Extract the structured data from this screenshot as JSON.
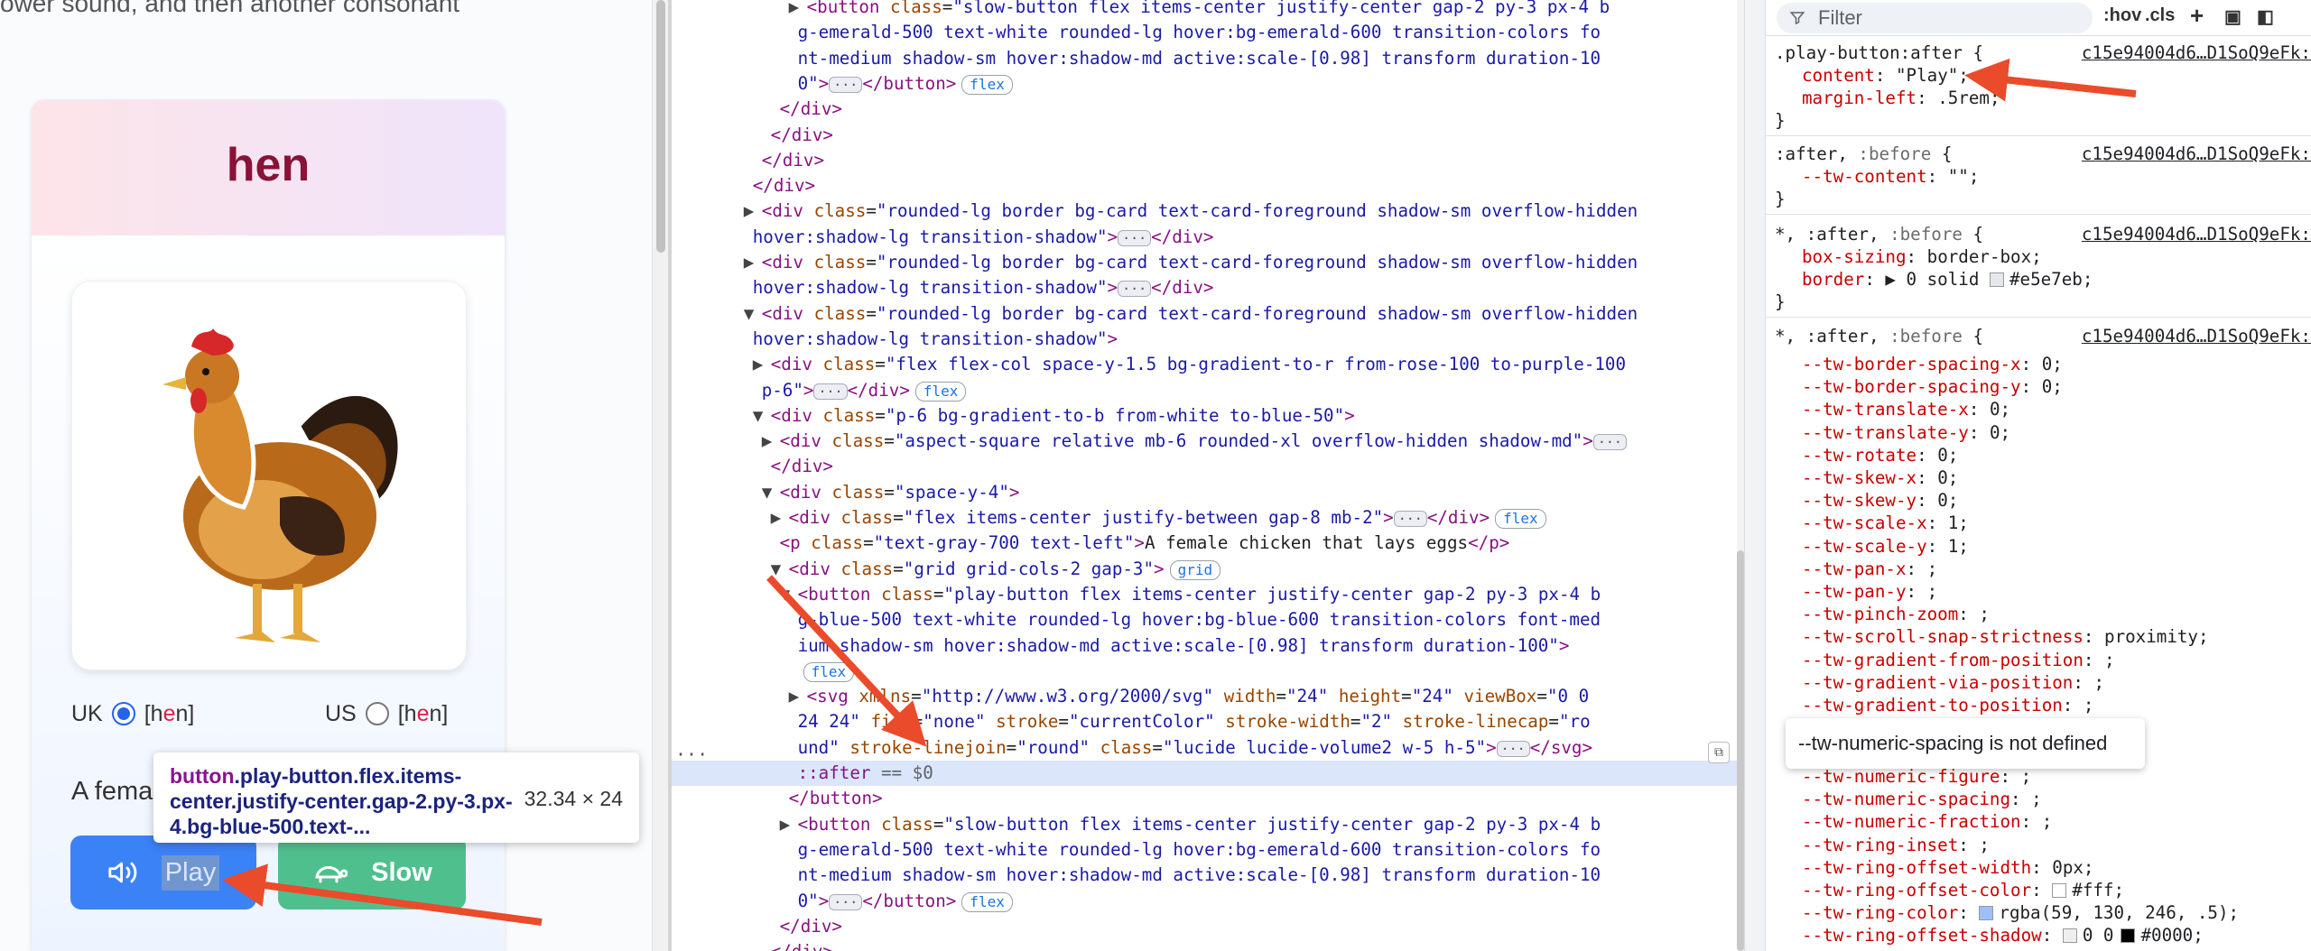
{
  "page": {
    "top_text": "ower sound, and then another consonant",
    "card": {
      "word": "hen",
      "uk_label": "UK",
      "uk_ipa_pre": "[h",
      "uk_ipa_mid": "e",
      "uk_ipa_post": "n]",
      "us_label": "US",
      "us_ipa_pre": "[h",
      "us_ipa_mid": "e",
      "us_ipa_post": "n]",
      "description_visible": "A fema",
      "play_label": "Play",
      "slow_label": "Slow"
    },
    "tooltip": {
      "selector_tag": "button",
      "selector_rest": ".play-button.flex.items-center.justify-center.gap-2.py-3.px-4.bg-blue-500.text-...",
      "size": "32.34 × 24"
    }
  },
  "elements": {
    "lines": [
      {
        "indent": 11,
        "html": "<span class='tri'>▶</span><span class='t'>&lt;button</span> <span class='an'>class</span>=<span class='av'>\"slow-button flex items-center justify-center gap-2 py-3 px-4 b</span>"
      },
      {
        "indent": 12,
        "html": "<span class='av'>g-emerald-500 text-white rounded-lg hover:bg-emerald-600 transition-colors fo</span>"
      },
      {
        "indent": 12,
        "html": "<span class='av'>nt-medium shadow-sm hover:shadow-md active:scale-[0.98] transform duration-10</span>"
      },
      {
        "indent": 12,
        "html": "<span class='av'>0\"</span><span class='t'>&gt;</span><span class='dots'>···</span><span class='t'>&lt;/button&gt;</span><span class='pill'>flex</span>"
      },
      {
        "indent": 10,
        "html": "<span class='t'>&lt;/div&gt;</span>"
      },
      {
        "indent": 9,
        "html": "<span class='t'>&lt;/div&gt;</span>"
      },
      {
        "indent": 8,
        "html": "<span class='t'>&lt;/div&gt;</span>"
      },
      {
        "indent": 7,
        "html": "<span class='t'>&lt;/div&gt;</span>"
      },
      {
        "indent": 6,
        "html": "<span class='tri'>▶</span><span class='t'>&lt;div</span> <span class='an'>class</span>=<span class='av'>\"rounded-lg border bg-card text-card-foreground shadow-sm overflow-hidden</span>"
      },
      {
        "indent": 7,
        "html": "<span class='av'>hover:shadow-lg transition-shadow\"</span><span class='t'>&gt;</span><span class='dots'>···</span><span class='t'>&lt;/div&gt;</span>"
      },
      {
        "indent": 6,
        "html": "<span class='tri'>▶</span><span class='t'>&lt;div</span> <span class='an'>class</span>=<span class='av'>\"rounded-lg border bg-card text-card-foreground shadow-sm overflow-hidden</span>"
      },
      {
        "indent": 7,
        "html": "<span class='av'>hover:shadow-lg transition-shadow\"</span><span class='t'>&gt;</span><span class='dots'>···</span><span class='t'>&lt;/div&gt;</span>"
      },
      {
        "indent": 6,
        "html": "<span class='tri'>▼</span><span class='t'>&lt;div</span> <span class='an'>class</span>=<span class='av'>\"rounded-lg border bg-card text-card-foreground shadow-sm overflow-hidden</span>"
      },
      {
        "indent": 7,
        "html": "<span class='av'>hover:shadow-lg transition-shadow\"</span><span class='t'>&gt;</span>"
      },
      {
        "indent": 7,
        "html": "<span class='tri'>▶</span><span class='t'>&lt;div</span> <span class='an'>class</span>=<span class='av'>\"flex flex-col space-y-1.5 bg-gradient-to-r from-rose-100 to-purple-100</span>"
      },
      {
        "indent": 8,
        "html": "<span class='av'>p-6\"</span><span class='t'>&gt;</span><span class='dots'>···</span><span class='t'>&lt;/div&gt;</span><span class='pill'>flex</span>"
      },
      {
        "indent": 7,
        "html": "<span class='tri'>▼</span><span class='t'>&lt;div</span> <span class='an'>class</span>=<span class='av'>\"p-6 bg-gradient-to-b from-white to-blue-50\"</span><span class='t'>&gt;</span>"
      },
      {
        "indent": 8,
        "html": "<span class='tri'>▶</span><span class='t'>&lt;div</span> <span class='an'>class</span>=<span class='av'>\"aspect-square relative mb-6 rounded-xl overflow-hidden shadow-md\"</span><span class='t'>&gt;</span><span class='dots'>···</span>"
      },
      {
        "indent": 9,
        "html": "<span class='t'>&lt;/div&gt;</span>"
      },
      {
        "indent": 8,
        "html": "<span class='tri'>▼</span><span class='t'>&lt;div</span> <span class='an'>class</span>=<span class='av'>\"space-y-4\"</span><span class='t'>&gt;</span>"
      },
      {
        "indent": 9,
        "html": "<span class='tri'>▶</span><span class='t'>&lt;div</span> <span class='an'>class</span>=<span class='av'>\"flex items-center justify-between gap-8 mb-2\"</span><span class='t'>&gt;</span><span class='dots'>···</span><span class='t'>&lt;/div&gt;</span><span class='pill'>flex</span>"
      },
      {
        "indent": 10,
        "html": "<span class='t'>&lt;p</span> <span class='an'>class</span>=<span class='av'>\"text-gray-700 text-left\"</span><span class='t'>&gt;</span>A female chicken that lays eggs<span class='t'>&lt;/p&gt;</span>"
      },
      {
        "indent": 9,
        "html": "<span class='tri'>▼</span><span class='t'>&lt;div</span> <span class='an'>class</span>=<span class='av'>\"grid grid-cols-2 gap-3\"</span><span class='t'>&gt;</span><span class='pill'>grid</span>"
      },
      {
        "indent": 10,
        "html": "<span class='tri'>▼</span><span class='t'>&lt;button</span> <span class='an'>class</span>=<span class='av'>\"play-button flex items-center justify-center gap-2 py-3 px-4 b</span>"
      },
      {
        "indent": 12,
        "html": "<span class='av'>g-blue-500 text-white rounded-lg hover:bg-blue-600 transition-colors font-med</span>"
      },
      {
        "indent": 12,
        "html": "<span class='av'>ium shadow-sm hover:shadow-md active:scale-[0.98] transform duration-100\"</span><span class='t'>&gt;</span>"
      },
      {
        "indent": 12,
        "html": "<span class='pill'>flex</span>"
      },
      {
        "indent": 11,
        "html": "<span class='tri'>▶</span><span class='t'>&lt;svg</span> <span class='an'>xmlns</span>=<span class='av'>\"http://www.w3.org/2000/svg\"</span> <span class='an'>width</span>=<span class='av'>\"24\"</span> <span class='an'>height</span>=<span class='av'>\"24\"</span> <span class='an'>viewBox</span>=<span class='av'>\"0 0</span>"
      },
      {
        "indent": 12,
        "html": "<span class='av'>24 24\"</span> <span class='an'>fill</span>=<span class='av'>\"none\"</span> <span class='an'>stroke</span>=<span class='av'>\"currentColor\"</span> <span class='an'>stroke-width</span>=<span class='av'>\"2\"</span> <span class='an'>stroke-linecap</span>=<span class='av'>\"ro</span>"
      },
      {
        "indent": 12,
        "html": "<span class='av'>und\"</span> <span class='an'>stroke-linejoin</span>=<span class='av'>\"round\"</span> <span class='an'>class</span>=<span class='av'>\"lucide lucide-volume2 w-5 h-5\"</span><span class='t'>&gt;</span><span class='dots'>···</span><span class='t'>&lt;/svg&gt;</span>"
      },
      {
        "indent": 12,
        "selected": true,
        "html": "<span class='t'>::after</span> <span class='cm'>== $0</span>"
      },
      {
        "indent": 11,
        "html": "<span class='t'>&lt;/button&gt;</span>"
      },
      {
        "indent": 10,
        "html": "<span class='tri'>▶</span><span class='t'>&lt;button</span> <span class='an'>class</span>=<span class='av'>\"slow-button flex items-center justify-center gap-2 py-3 px-4 b</span>"
      },
      {
        "indent": 12,
        "html": "<span class='av'>g-emerald-500 text-white rounded-lg hover:bg-emerald-600 transition-colors fo</span>"
      },
      {
        "indent": 12,
        "html": "<span class='av'>nt-medium shadow-sm hover:shadow-md active:scale-[0.98] transform duration-10</span>"
      },
      {
        "indent": 12,
        "html": "<span class='av'>0\"</span><span class='t'>&gt;</span><span class='dots'>···</span><span class='t'>&lt;/button&gt;</span><span class='pill'>flex</span>"
      },
      {
        "indent": 10,
        "html": "<span class='t'>&lt;/div&gt;</span>"
      },
      {
        "indent": 9,
        "html": "<span class='t'>&lt;/div&gt;</span>"
      }
    ]
  },
  "styles": {
    "filter_placeholder": "Filter",
    "hov": ":hov",
    "cls": ".cls",
    "source": "c15e94004d6…D1SoQ9eFk:",
    "play_after_selector": ".play-button:after {",
    "play_after_content_name": "content",
    "play_after_content_value": "\"Play\";",
    "play_after_margin_name": "margin-left",
    "play_after_margin_value": ".5rem;",
    "after_before_selector_a": ":after",
    "after_before_selector_b": ":before",
    "tw_content_name": "--tw-content",
    "tw_content_value": "\"\";",
    "box_sizing_name": "box-sizing",
    "box_sizing_value": "border-box;",
    "border_name": "border",
    "border_value": "0 solid",
    "border_color": "#e5e7eb;",
    "closing": "}",
    "tw_vars": [
      {
        "name": "--tw-border-spacing-x",
        "value": "0;"
      },
      {
        "name": "--tw-border-spacing-y",
        "value": "0;"
      },
      {
        "name": "--tw-translate-x",
        "value": "0;"
      },
      {
        "name": "--tw-translate-y",
        "value": "0;"
      },
      {
        "name": "--tw-rotate",
        "value": "0;"
      },
      {
        "name": "--tw-skew-x",
        "value": "0;"
      },
      {
        "name": "--tw-skew-y",
        "value": "0;"
      },
      {
        "name": "--tw-scale-x",
        "value": "1;"
      },
      {
        "name": "--tw-scale-y",
        "value": "1;"
      },
      {
        "name": "--tw-pan-x",
        "value": ";"
      },
      {
        "name": "--tw-pan-y",
        "value": ";"
      },
      {
        "name": "--tw-pinch-zoom",
        "value": ";"
      },
      {
        "name": "--tw-scroll-snap-strictness",
        "value": "proximity;"
      },
      {
        "name": "--tw-gradient-from-position",
        "value": ";"
      },
      {
        "name": "--tw-gradient-via-position",
        "value": ";"
      },
      {
        "name": "--tw-gradient-to-position",
        "value": ";"
      }
    ],
    "tw_vars_after": [
      {
        "name": "--tw-numeric-figure",
        "value": ";"
      },
      {
        "name": "--tw-numeric-spacing",
        "value": ";"
      },
      {
        "name": "--tw-numeric-fraction",
        "value": ";"
      },
      {
        "name": "--tw-ring-inset",
        "value": ";"
      },
      {
        "name": "--tw-ring-offset-width",
        "value": "0px;"
      },
      {
        "name": "--tw-ring-offset-color",
        "value": "#fff;",
        "swatch": "#ffffff"
      },
      {
        "name": "--tw-ring-color",
        "value": "rgba(59, 130, 246, .5);",
        "swatch": "#9dc0fa"
      },
      {
        "name": "--tw-ring-offset-shadow",
        "value": "0 0",
        "value2": "#0000;",
        "swatch": "#eeeeee"
      }
    ],
    "numeric_tooltip": "--tw-numeric-spacing is not defined"
  }
}
